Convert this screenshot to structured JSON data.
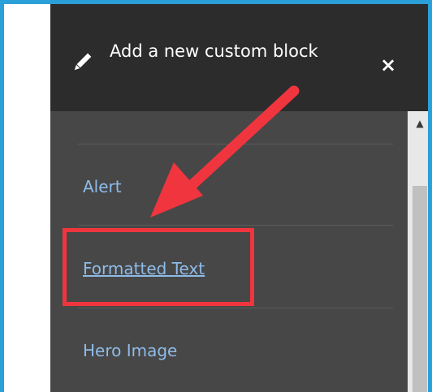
{
  "tray": {
    "title": "Add a new custom block",
    "close_glyph": "×",
    "pencil_icon": "pencil-icon",
    "close_icon": "close-icon"
  },
  "block_types": [
    {
      "label": "Alert"
    },
    {
      "label": "Formatted Text",
      "highlighted": true
    },
    {
      "label": "Hero Image"
    }
  ],
  "colors": {
    "frame_border": "#2a9fd8",
    "tray_header": "#2c2c2c",
    "tray_body": "#474747",
    "link": "#8ebbe8",
    "annotation": "#f0353f"
  }
}
